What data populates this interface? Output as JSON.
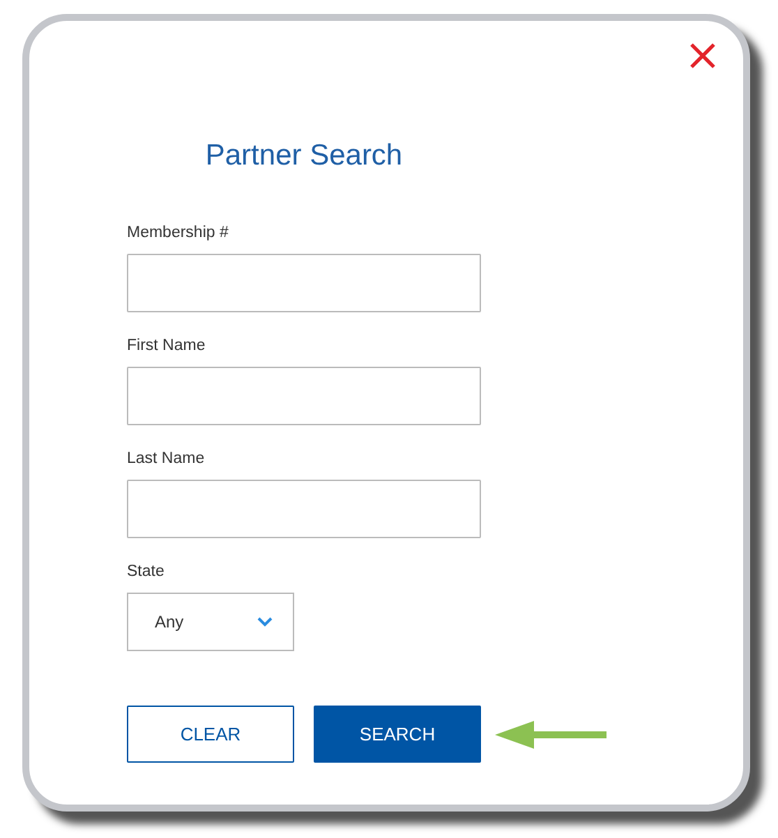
{
  "dialog": {
    "title": "Partner Search"
  },
  "fields": [
    {
      "label": "Membership #",
      "kind": "text"
    },
    {
      "label": "First Name",
      "kind": "text"
    },
    {
      "label": "Last Name",
      "kind": "text"
    },
    {
      "label": "State",
      "kind": "select",
      "value": "Any"
    }
  ],
  "buttons": [
    {
      "label": "CLEAR",
      "kind": "secondary"
    },
    {
      "label": "SEARCH",
      "kind": "primary"
    }
  ]
}
